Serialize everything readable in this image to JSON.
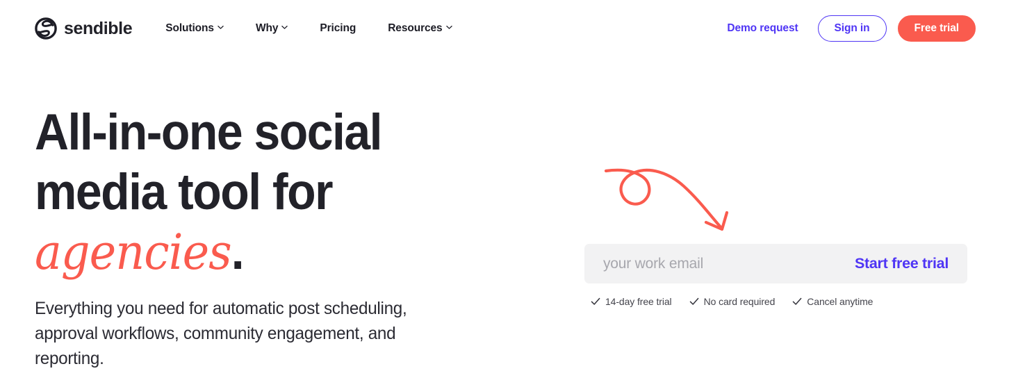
{
  "brand": {
    "name": "sendible",
    "logo_icon": "sendible-circle-s-logo"
  },
  "nav": {
    "items": [
      {
        "label": "Solutions",
        "has_caret": true
      },
      {
        "label": "Why",
        "has_caret": true
      },
      {
        "label": "Pricing",
        "has_caret": false
      },
      {
        "label": "Resources",
        "has_caret": true
      }
    ],
    "demo_request_label": "Demo request",
    "sign_in_label": "Sign in",
    "free_trial_label": "Free trial"
  },
  "hero": {
    "headline_line1": "All-in-one social",
    "headline_line2_prefix": "media tool for ",
    "headline_accent": "agencies",
    "headline_period": ".",
    "subheadline": "Everything you need for automatic post scheduling, approval workflows, community engagement, and reporting."
  },
  "signup": {
    "email_placeholder": "your work email",
    "email_value": "",
    "submit_label": "Start free trial",
    "perks": [
      {
        "label": "14-day free trial",
        "icon": "check-icon"
      },
      {
        "label": "No card required",
        "icon": "check-icon"
      },
      {
        "label": "Cancel anytime",
        "icon": "check-icon"
      }
    ]
  },
  "decoration": {
    "arrow_icon": "hand-drawn-looping-arrow"
  },
  "colors": {
    "coral": "#fa5b4e",
    "violet": "#4f35f5",
    "ink": "#222229",
    "field_bg": "#f2f2f3",
    "placeholder": "#a7a7ad"
  }
}
